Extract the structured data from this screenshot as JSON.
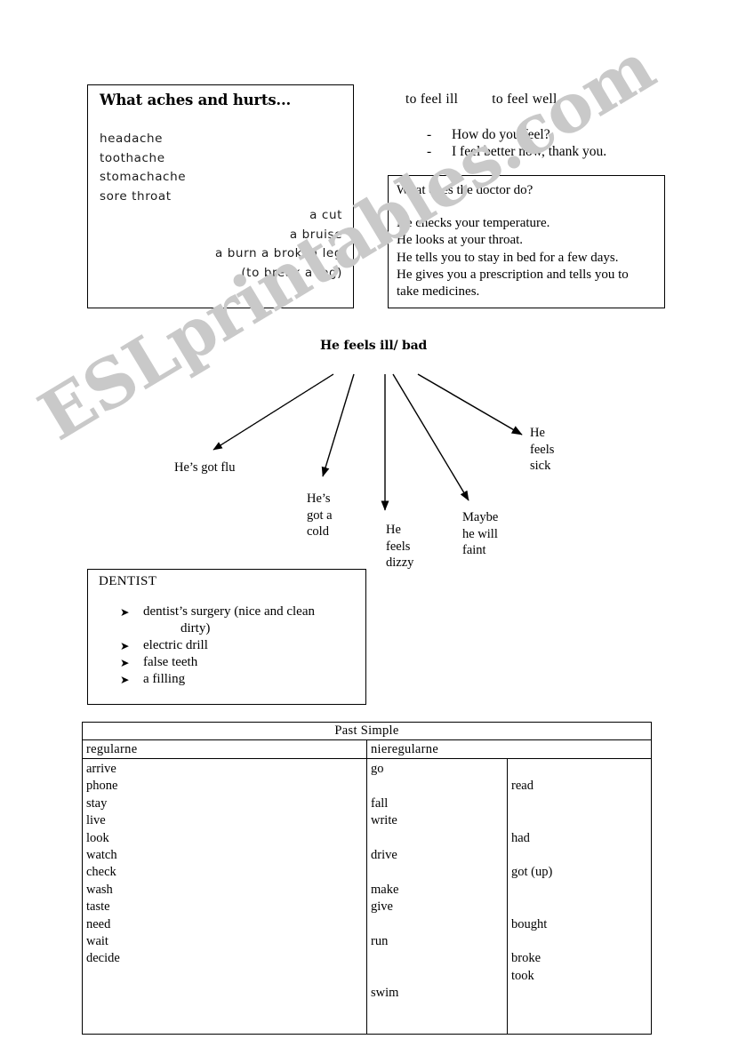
{
  "watermark": {
    "text": "ESLprintables.com",
    "color": "#c9c9c9"
  },
  "aches_box": {
    "title": "What aches and hurts...",
    "left_items": [
      "headache",
      "toothache",
      "stomachache",
      "sore throat"
    ],
    "right_items": [
      "a cut",
      "a bruise",
      "a burn a broken leg",
      "(to break a leg)"
    ]
  },
  "feel_line": {
    "ill": "to feel ill",
    "well": "to feel well"
  },
  "dialog": {
    "dash": "-",
    "lines": [
      "How do you feel?",
      "I feel better now, thank you."
    ]
  },
  "doctor_box": {
    "question": "What does the doctor do?",
    "answers": [
      "He checks your temperature.",
      "He looks at your throat.",
      "He tells you to stay in bed for a few days.",
      "He gives you a prescription and tells you to",
      "take medicines."
    ]
  },
  "mindmap": {
    "title": "He feels ill/ bad",
    "nodes": [
      {
        "id": "flu",
        "lines": [
          "He’s got flu"
        ]
      },
      {
        "id": "cold",
        "lines": [
          "He’s",
          "got a",
          "cold"
        ]
      },
      {
        "id": "dizzy",
        "lines": [
          "He",
          "feels",
          "dizzy"
        ]
      },
      {
        "id": "faint",
        "lines": [
          "Maybe",
          "he will",
          "faint"
        ]
      },
      {
        "id": "sick",
        "lines": [
          "He",
          "feels",
          "sick"
        ]
      }
    ]
  },
  "dentist_box": {
    "heading": "DENTIST",
    "bullet_glyph": "➤",
    "items": [
      {
        "text": "dentist’s surgery (nice and clean",
        "cont": "dirty)"
      },
      {
        "text": "electric drill",
        "cont": ""
      },
      {
        "text": "false teeth",
        "cont": ""
      },
      {
        "text": "a filling",
        "cont": ""
      }
    ]
  },
  "past_simple": {
    "title": "Past Simple",
    "head_regular": "regularne",
    "head_irregular": "nieregularne",
    "regular": [
      "arrive",
      "phone",
      "stay",
      "live",
      "look",
      "watch",
      "check",
      "wash",
      "taste",
      "need",
      "wait",
      "decide"
    ],
    "irregular_col1": [
      "go",
      "",
      "fall",
      "write",
      "",
      "drive",
      "",
      "make",
      "give",
      "",
      "run",
      "",
      "",
      "swim"
    ],
    "irregular_col2": [
      "",
      "read",
      "",
      "",
      "had",
      "",
      "got (up)",
      "",
      "",
      "bought",
      "",
      "broke",
      "took",
      ""
    ]
  }
}
